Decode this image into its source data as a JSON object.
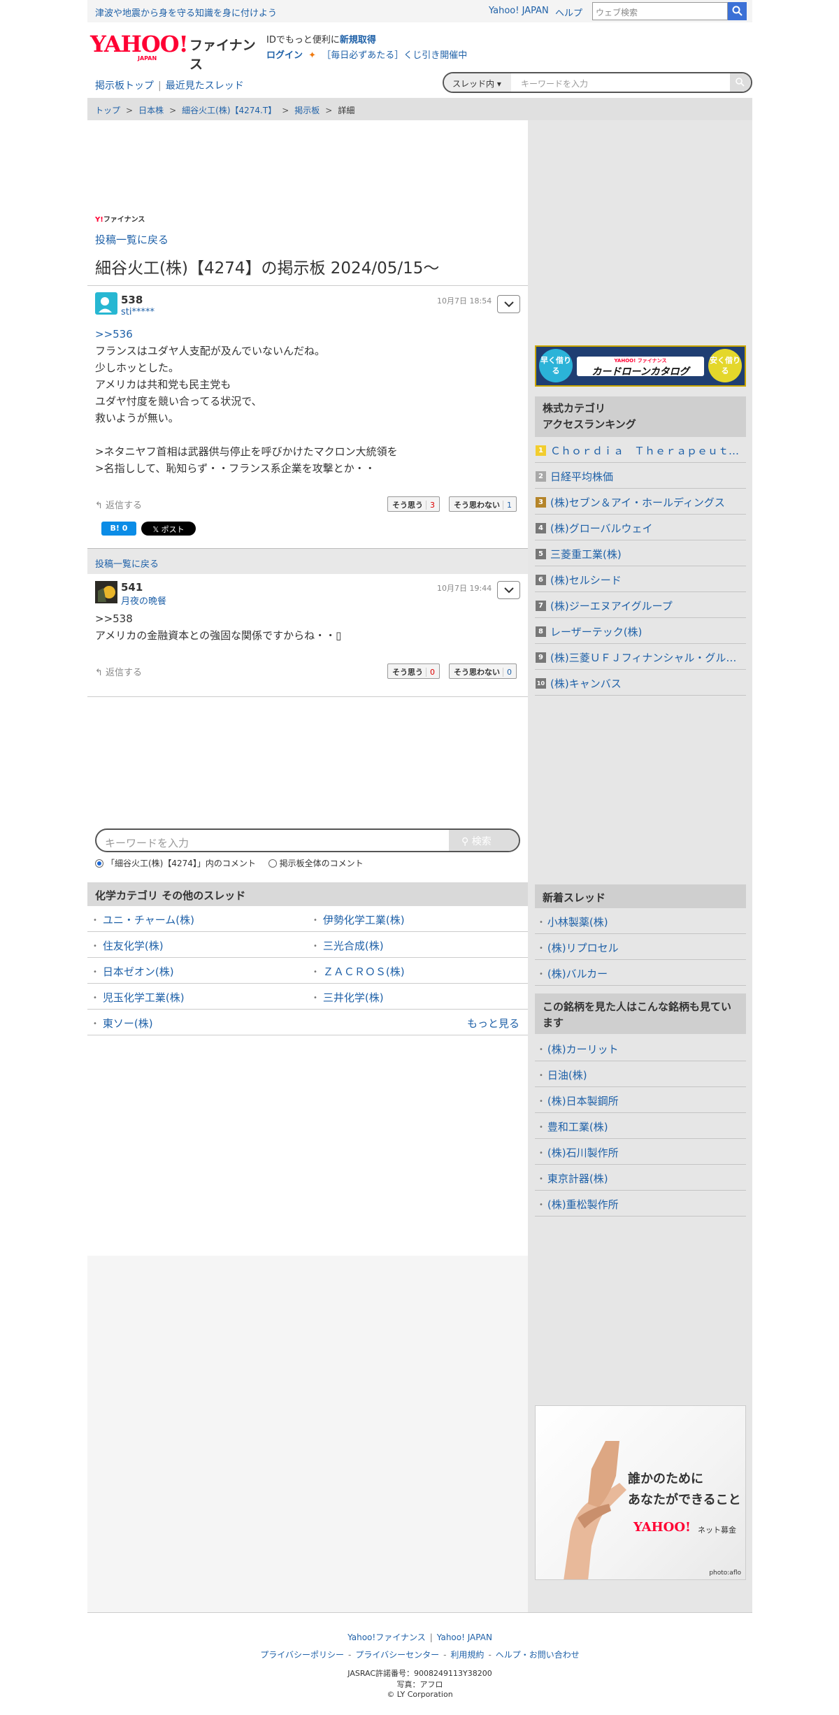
{
  "topbar": {
    "notice": "津波や地震から身を守る知識を身に付けよう",
    "yahoo_japan": "Yahoo! JAPAN",
    "help": "ヘルプ",
    "web_search_placeholder": "ウェブ検索"
  },
  "header": {
    "logo_text": "YAHOO!",
    "logo_sub": "JAPAN",
    "logo_fin": "ファイナンス",
    "id_line_prefix": "IDでもっと便利に",
    "id_line_link": "新規取得",
    "login": "ログイン",
    "lottery": "［毎日必ずあたる］くじ引き開催中"
  },
  "nav": {
    "board_top": "掲示板トップ",
    "recent_threads": "最近見たスレッド",
    "search_scope": "スレッド内",
    "search_placeholder": "キーワードを入力"
  },
  "breadcrumb": [
    "トップ",
    "日本株",
    "細谷火工(株)【4274.T】",
    "掲示板",
    "詳細"
  ],
  "board": {
    "small_logo_y": "Y!",
    "small_logo_text": "ファイナンス",
    "back_to_list": "投稿一覧に戻る",
    "title": "細谷火工(株)【4274】の掲示板 2024/05/15〜"
  },
  "posts": [
    {
      "number": "538",
      "user": "sti*****",
      "time": "10月7日 18:54",
      "anchor": ">>536",
      "lines": [
        "フランスはユダヤ人支配が及んでいないんだね。",
        "少しホッとした。",
        "アメリカは共和党も民主党も",
        "ユダヤ忖度を競い合ってる状況で、",
        "救いようが無い。",
        "",
        ">ネタニヤフ首相は武器供与停止を呼びかけたマクロン大統領を",
        ">名指しして、恥知らず・・フランス系企業を攻撃とか・・"
      ],
      "reply": "返信する",
      "agree_label": "そう思う",
      "agree_count": "3",
      "disagree_label": "そう思わない",
      "disagree_count": "1",
      "hatena": "B! 0",
      "x_post": "𝕏 ポスト"
    },
    {
      "number": "541",
      "user": "月夜の晩餐",
      "time": "10月7日 19:44",
      "anchor": "",
      "lines": [
        ">>538",
        "アメリカの金融資本との強固な関係ですからね・・▯"
      ],
      "reply": "返信する",
      "agree_label": "そう思う",
      "agree_count": "0",
      "disagree_label": "そう思わない",
      "disagree_count": "0"
    }
  ],
  "back_bar": "投稿一覧に戻る",
  "keyword_search": {
    "placeholder": "キーワードを入力",
    "button": "検索",
    "radio_in_board": "「細谷火工(株)【4274】」内のコメント",
    "radio_all": "掲示板全体のコメント"
  },
  "chem": {
    "title": "化学カテゴリ その他のスレッド",
    "rows": [
      [
        "ユニ・チャーム(株)",
        "伊勢化学工業(株)"
      ],
      [
        "住友化学(株)",
        "三光合成(株)"
      ],
      [
        "日本ゼオン(株)",
        "ＺＡＣＲＯＳ(株)"
      ],
      [
        "児玉化学工業(株)",
        "三井化学(株)"
      ],
      [
        "東ソー(株)",
        ""
      ]
    ],
    "more": "もっと見る"
  },
  "ad_banner": {
    "left": "早く借りる",
    "brand": "YAHOO! ファイナンス",
    "center": "カードローンカタログ",
    "right": "安く借りる"
  },
  "ranking": {
    "title_line1": "株式カテゴリ",
    "title_line2": "アクセスランキング",
    "items": [
      "Ｃｈｏｒｄｉａ　Ｔｈｅｒａｐｅｕｔｉｃｓ",
      "日経平均株価",
      "(株)セブン＆アイ・ホールディングス",
      "(株)グローバルウェイ",
      "三菱重工業(株)",
      "(株)セルシード",
      "(株)ジーエヌアイグループ",
      "レーザーテック(株)",
      "(株)三菱ＵＦＪフィナンシャル・グループ",
      "(株)キャンバス"
    ]
  },
  "new_threads": {
    "title": "新着スレッド",
    "items": [
      "小林製薬(株)",
      "(株)リプロセル",
      "(株)バルカー"
    ]
  },
  "also_viewed": {
    "title": "この銘柄を見た人はこんな銘柄も見ています",
    "items": [
      "(株)カーリット",
      "日油(株)",
      "(株)日本製鋼所",
      "豊和工業(株)",
      "(株)石川製作所",
      "東京計器(株)",
      "(株)重松製作所"
    ]
  },
  "ad_photo": {
    "line1": "誰かのために",
    "line2": "あなたができること",
    "brand": "YAHOO!",
    "service": "ネット募金",
    "credit": "photo:aflo"
  },
  "footer": {
    "links1": [
      "Yahoo!ファイナンス",
      "Yahoo! JAPAN"
    ],
    "links2": [
      "プライバシーポリシー",
      "プライバシーセンター",
      "利用規約",
      "ヘルプ・お問い合わせ"
    ],
    "jasrac": "JASRAC許諾番号：9008249113Y38200",
    "photo": "写真：アフロ",
    "copyright": "© LY Corporation"
  }
}
